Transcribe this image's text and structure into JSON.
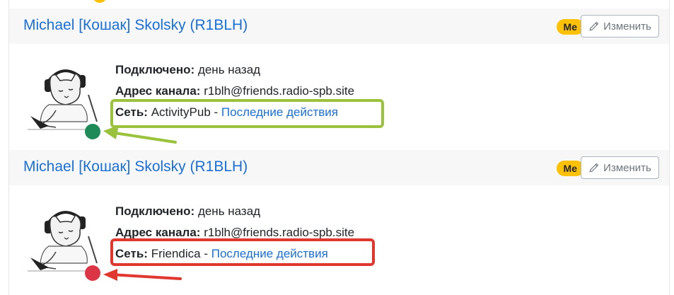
{
  "cards": [
    {
      "name": "Michael [Кошак] Skolsky (R1BLH)",
      "badge": "Me",
      "edit_label": "Изменить",
      "connected_label": "Подключено:",
      "connected_value": "день назад",
      "address_label": "Адрес канала:",
      "address_value": "r1blh@friends.radio-spb.site",
      "network_label": "Сеть:",
      "network_value": "ActivityPub",
      "separator": "-",
      "recent_link": "Последние действия",
      "status_color": "#1e8a57",
      "highlight_color": "#9ac23c"
    },
    {
      "name": "Michael [Кошак] Skolsky (R1BLH)",
      "badge": "Me",
      "edit_label": "Изменить",
      "connected_label": "Подключено:",
      "connected_value": "день назад",
      "address_label": "Адрес канала:",
      "address_value": "r1blh@friends.radio-spb.site",
      "network_label": "Сеть:",
      "network_value": "Friendica",
      "separator": "-",
      "recent_link": "Последние действия",
      "status_color": "#dc3545",
      "highlight_color": "#e0382f"
    }
  ],
  "icons": {
    "edit": "pencil-icon",
    "avatar": "cat-with-headphones-avatar",
    "status": "status-dot-icon"
  }
}
